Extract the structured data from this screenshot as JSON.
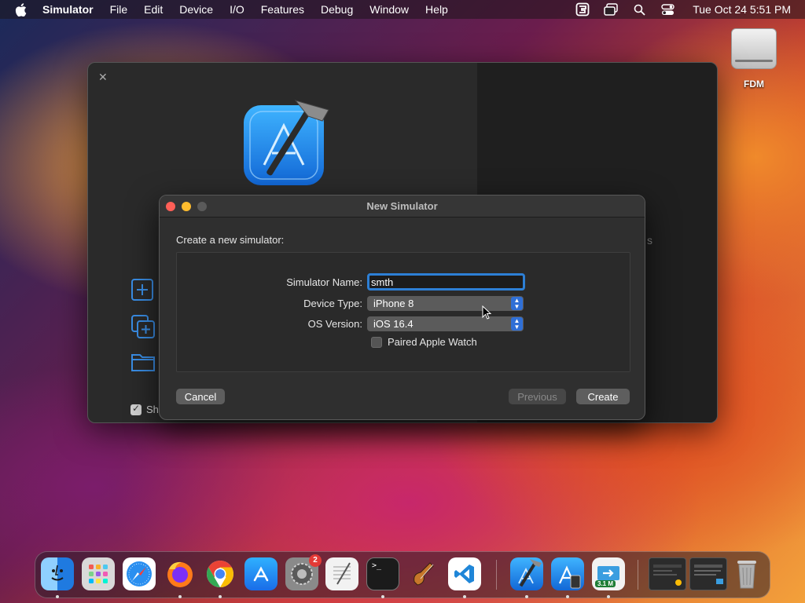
{
  "menubar": {
    "app_name": "Simulator",
    "items": [
      "File",
      "Edit",
      "Device",
      "I/O",
      "Features",
      "Debug",
      "Window",
      "Help"
    ],
    "clock": "Tue Oct 24  5:51 PM",
    "status_icons": [
      "screen-capture-icon",
      "window-icon",
      "search-icon",
      "control-center-icon"
    ]
  },
  "desktop": {
    "drive_label": "FDM"
  },
  "welcome": {
    "right_partial_text": "s",
    "show_checkbox_partial_label": "Sh",
    "actions": [
      "add-icon",
      "clone-icon",
      "folder-icon"
    ]
  },
  "dialog": {
    "title": "New Simulator",
    "heading": "Create a new simulator:",
    "fields": {
      "name_label": "Simulator Name:",
      "name_value": "smth",
      "device_label": "Device Type:",
      "device_value": "iPhone 8",
      "os_label": "OS Version:",
      "os_value": "iOS 16.4",
      "watch_label": "Paired Apple Watch"
    },
    "buttons": {
      "cancel": "Cancel",
      "previous": "Previous",
      "create": "Create"
    }
  },
  "dock": {
    "apps": [
      {
        "name": "Finder",
        "icon": "finder-icon",
        "color": "#2e8ae6"
      },
      {
        "name": "Launchpad",
        "icon": "launchpad-icon",
        "color": "#d9d9d9"
      },
      {
        "name": "Safari",
        "icon": "safari-icon",
        "color": "#2a8ff0"
      },
      {
        "name": "Firefox",
        "icon": "firefox-icon",
        "color": "#ff7a1a"
      },
      {
        "name": "Chrome",
        "icon": "chrome-icon",
        "color": "#ffffff"
      },
      {
        "name": "App Store",
        "icon": "app-store-icon",
        "color": "#1f8cf5"
      },
      {
        "name": "System Settings",
        "icon": "settings-icon",
        "color": "#8a8a8a"
      },
      {
        "name": "TextEdit",
        "icon": "textedit-icon",
        "color": "#f2f2f2"
      },
      {
        "name": "Terminal",
        "icon": "terminal-icon",
        "color": "#1b1b1b"
      },
      {
        "name": "Instruments",
        "icon": "instruments-icon",
        "color": "#3a3a3a"
      },
      {
        "name": "VS Code",
        "icon": "vscode-icon",
        "color": "#ffffff"
      },
      {
        "name": "Xcode",
        "icon": "xcode-icon",
        "color": "#2a88e8"
      },
      {
        "name": "Simulator",
        "icon": "simulator-icon",
        "color": "#2a88e8"
      },
      {
        "name": "FDM",
        "icon": "fdm-icon",
        "color": "#3a9ee0"
      },
      {
        "name": "Window 1",
        "icon": "window-thumb-icon",
        "color": "#2b2b2b"
      },
      {
        "name": "Window 2",
        "icon": "window-thumb-icon",
        "color": "#2b2b2b"
      },
      {
        "name": "Trash",
        "icon": "trash-icon",
        "color": "#9a9a9a"
      }
    ],
    "settings_badge": "2",
    "fdm_speed": "3.1 M",
    "terminal_glyph": ">_"
  }
}
